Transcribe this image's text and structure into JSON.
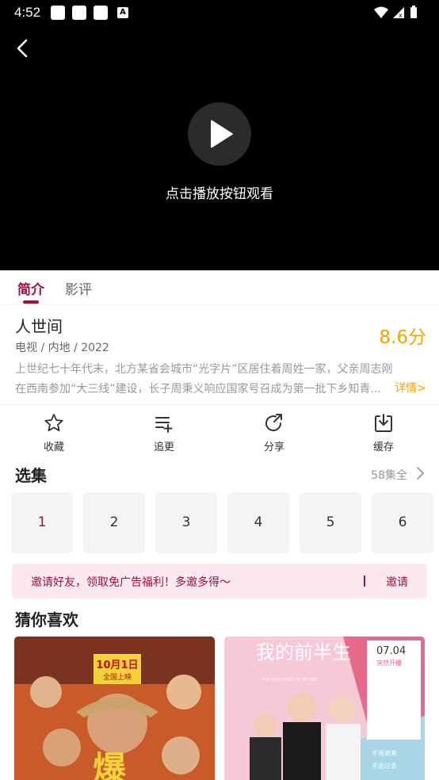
{
  "status_bar": {
    "time": "4:52",
    "notif_letter": "A"
  },
  "player": {
    "hint": "点击播放按钮观看"
  },
  "tabs": [
    {
      "label": "简介"
    },
    {
      "label": "影评"
    }
  ],
  "show": {
    "title": "人世间",
    "score": "8.6分",
    "meta": "电视 / 内地 / 2022",
    "description": "上世纪七十年代末，北方某省会城市“光字片”区居住着周姓一家，父亲周志刚在西南参加“大三线”建设，长子周秉义响应国家号召成为第一批下乡知青...",
    "more_label": "详情>"
  },
  "actions": [
    {
      "label": "收藏",
      "icon": "star-icon"
    },
    {
      "label": "追更",
      "icon": "playlist-add-icon"
    },
    {
      "label": "分享",
      "icon": "share-icon"
    },
    {
      "label": "缓存",
      "icon": "download-icon"
    }
  ],
  "episodes": {
    "title": "选集",
    "count_label": "58集全",
    "items": [
      "1",
      "2",
      "3",
      "4",
      "5",
      "6"
    ],
    "selected": "1"
  },
  "invite": {
    "text": "邀请好友，领取免广告福利！多邀多得～",
    "button": "邀请"
  },
  "recommend": {
    "title": "猜你喜欢",
    "posters": [
      {
        "date_text": "10月1日",
        "sub_text": "全国上映",
        "big_text": "爆"
      },
      {
        "title_text": "我的前半生",
        "en_text": "THE FIRST HALF OF MY LIFE",
        "date_text": "07.04",
        "sub_text": "突然开播",
        "tagline_1": "不畏将来",
        "tagline_2": "不念过去"
      }
    ]
  },
  "colors": {
    "accent": "#a0103e",
    "score": "#f0a400"
  }
}
